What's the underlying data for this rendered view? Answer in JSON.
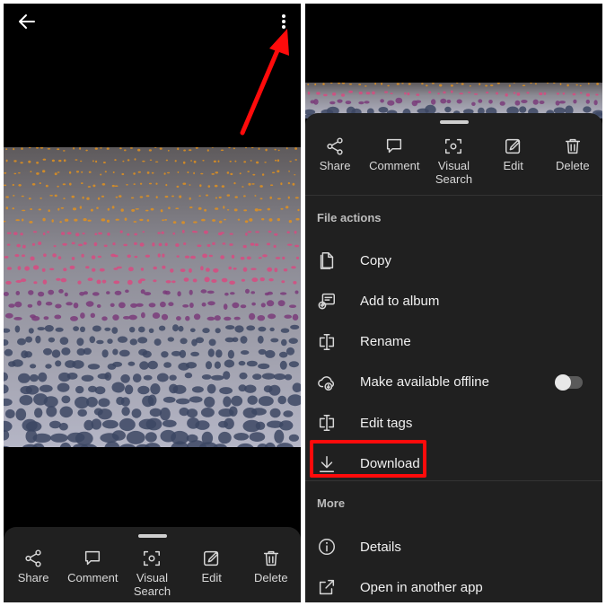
{
  "left": {
    "back_icon": "arrow-left-icon",
    "more_icon": "more-vertical-icon",
    "actions": [
      {
        "label": "Share",
        "icon": "share-icon"
      },
      {
        "label": "Comment",
        "icon": "comment-icon"
      },
      {
        "label": "Visual Search",
        "icon": "visual-search-icon"
      },
      {
        "label": "Edit",
        "icon": "edit-icon"
      },
      {
        "label": "Delete",
        "icon": "trash-icon"
      }
    ]
  },
  "right": {
    "actions": [
      {
        "label": "Share",
        "icon": "share-icon"
      },
      {
        "label": "Comment",
        "icon": "comment-icon"
      },
      {
        "label": "Visual Search",
        "icon": "visual-search-icon"
      },
      {
        "label": "Edit",
        "icon": "edit-icon"
      },
      {
        "label": "Delete",
        "icon": "trash-icon"
      }
    ],
    "file_actions_header": "File actions",
    "file_actions": [
      {
        "label": "Copy",
        "icon": "copy-icon"
      },
      {
        "label": "Add to album",
        "icon": "add-to-album-icon"
      },
      {
        "label": "Rename",
        "icon": "rename-icon"
      },
      {
        "label": "Make available offline",
        "icon": "cloud-download-icon",
        "toggle": false
      },
      {
        "label": "Edit tags",
        "icon": "tag-icon"
      },
      {
        "label": "Download",
        "icon": "download-icon"
      }
    ],
    "more_header": "More",
    "more_actions": [
      {
        "label": "Details",
        "icon": "info-icon"
      },
      {
        "label": "Open in another app",
        "icon": "open-external-icon"
      }
    ]
  },
  "colors": {
    "sheet_background": "#202020",
    "annotation_red": "#ff0b0b"
  }
}
